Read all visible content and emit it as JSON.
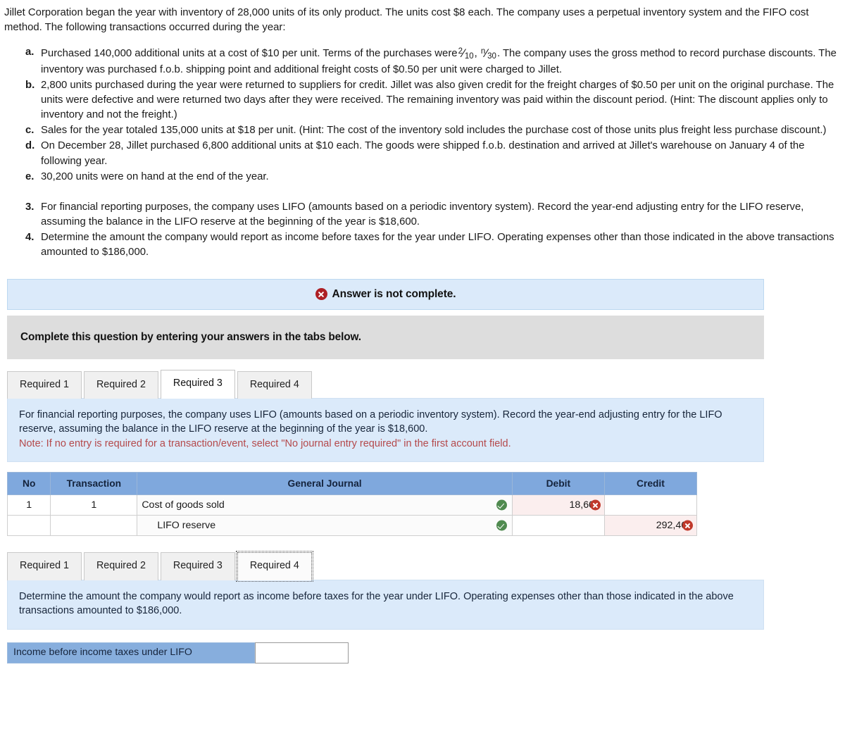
{
  "problem": {
    "intro": "Jillet Corporation began the year with inventory of 28,000 units of its only product. The units cost $8 each. The company uses a perpetual inventory system and the FIFO cost method. The following transactions occurred during the year:",
    "items": [
      {
        "label": "a.",
        "text_before": "Purchased 140,000 additional units at a cost of $10 per unit. Terms of the purchases were",
        "frac1_num": "2",
        "frac1_den": "10",
        "frac_sep": ",",
        "frac2_num": "n",
        "frac2_den": "30",
        "text_after": ". The company uses the gross method to record purchase discounts. The inventory was purchased f.o.b. shipping point and additional freight costs of $0.50 per unit were charged to Jillet."
      },
      {
        "label": "b.",
        "text": "2,800 units purchased during the year were returned to suppliers for credit. Jillet was also given credit for the freight charges of $0.50 per unit on the original purchase. The units were defective and were returned two days after they were received. The remaining inventory was paid within the discount period. (Hint: The discount applies only to inventory and not the freight.)"
      },
      {
        "label": "c.",
        "text": "Sales for the year totaled 135,000 units at $18 per unit. (Hint: The cost of the inventory sold includes the purchase cost of those units plus freight less purchase discount.)"
      },
      {
        "label": "d.",
        "text": "On December 28, Jillet purchased 6,800 additional units at $10 each. The goods were shipped f.o.b. destination and arrived at Jillet's warehouse on January 4 of the following year."
      },
      {
        "label": "e.",
        "text": "30,200 units were on hand at the end of the year."
      }
    ],
    "numbered_items": [
      {
        "label": "3.",
        "text": "For financial reporting purposes, the company uses LIFO (amounts based on a periodic inventory system). Record the year-end adjusting entry for the LIFO reserve, assuming the balance in the LIFO reserve at the beginning of the year is $18,600."
      },
      {
        "label": "4.",
        "text": "Determine the amount the company would report as income before taxes for the year under LIFO. Operating expenses other than those indicated in the above transactions amounted to $186,000."
      }
    ]
  },
  "alert": {
    "icon": "x-circle-icon",
    "text": "Answer is not complete.",
    "background": "#dbeafa",
    "icon_color": "#ad1f24"
  },
  "instruction_band": {
    "text": "Complete this question by entering your answers in the tabs below.",
    "background": "#dddddd"
  },
  "tabs_top": {
    "items": [
      {
        "label": "Required 1",
        "state": "inactive"
      },
      {
        "label": "Required 2",
        "state": "inactive"
      },
      {
        "label": "Required 3",
        "state": "active"
      },
      {
        "label": "Required 4",
        "state": "inactive"
      }
    ]
  },
  "panel_required3": {
    "background": "#dbeafa",
    "text": "For financial reporting purposes, the company uses LIFO (amounts based on a periodic inventory system). Record the year-end adjusting entry for the LIFO reserve, assuming the balance in the LIFO reserve at the beginning of the year is $18,600.",
    "note": "Note: If no entry is required for a transaction/event, select \"No journal entry required\" in the first account field.",
    "note_color": "#b4494b"
  },
  "journal_table": {
    "header_background": "#7fa8dd",
    "columns": [
      "No",
      "Transaction",
      "General Journal",
      "Debit",
      "Credit"
    ],
    "rows": [
      {
        "no": "1",
        "transaction": "1",
        "account": "Cost of goods sold",
        "account_status": "correct",
        "indent": false,
        "debit": "18,600",
        "debit_status": "incorrect",
        "credit": "",
        "credit_status": "none"
      },
      {
        "no": "",
        "transaction": "",
        "account": "LIFO reserve",
        "account_status": "correct",
        "indent": true,
        "debit": "",
        "debit_status": "none",
        "credit": "292,460",
        "credit_status": "incorrect"
      }
    ]
  },
  "tabs_bottom": {
    "items": [
      {
        "label": "Required 1",
        "state": "inactive"
      },
      {
        "label": "Required 2",
        "state": "inactive"
      },
      {
        "label": "Required 3",
        "state": "inactive"
      },
      {
        "label": "Required 4",
        "state": "focus"
      }
    ]
  },
  "panel_required4": {
    "background": "#dbeafa",
    "text": "Determine the amount the company would report as income before taxes for the year under LIFO. Operating expenses other than those indicated in the above transactions amounted to $186,000."
  },
  "answer_row": {
    "label": "Income before income taxes under LIFO",
    "value": "",
    "placeholder": "",
    "label_background": "#87aedd"
  }
}
